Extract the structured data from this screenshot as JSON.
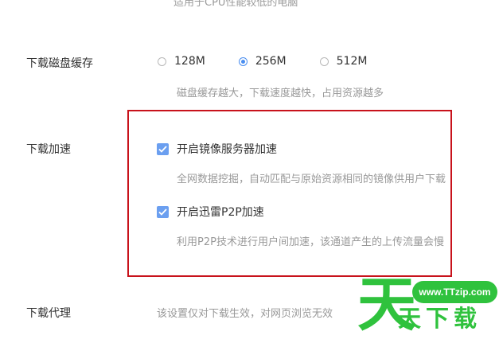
{
  "top_hint": "适用于CPU性能较低的电脑",
  "disk_cache": {
    "label": "下载磁盘缓存",
    "options": [
      "128M",
      "256M",
      "512M"
    ],
    "selected": "256M",
    "hint": "磁盘缓存越大，下载速度越快，占用资源越多"
  },
  "acceleration": {
    "label": "下载加速",
    "mirror": {
      "label": "开启镜像服务器加速",
      "checked": true,
      "hint": "全网数据挖掘，自动匹配与原始资源相同的镜像供用户下载"
    },
    "p2p": {
      "label": "开启迅雷P2P加速",
      "checked": true,
      "hint": "利用P2P技术进行用户间加速，该通道产生的上传流量会慢"
    }
  },
  "proxy": {
    "label": "下载代理",
    "hint": "该设置仅对下载生效，对网页浏览无效"
  },
  "watermark": {
    "big_char": "天",
    "url": "www.TTzip.com",
    "brand": "天下载",
    "color": "#2fc23d"
  },
  "colors": {
    "accent": "#4a8ef0",
    "highlight_box": "#c8121b"
  }
}
